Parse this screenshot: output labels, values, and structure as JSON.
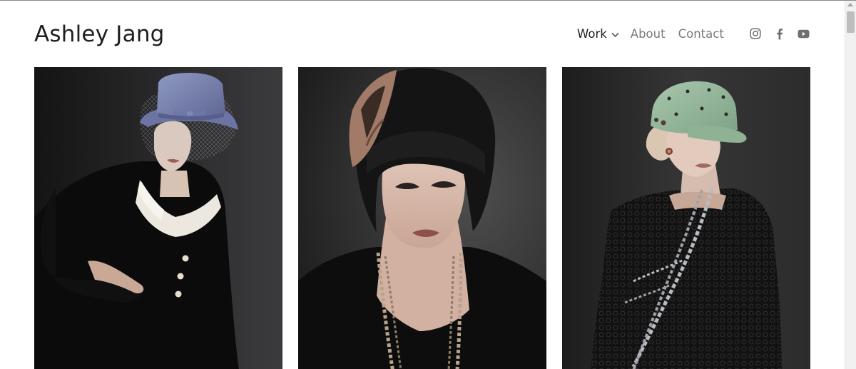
{
  "site": {
    "title": "Ashley Jang"
  },
  "nav": {
    "items": [
      {
        "label": "Work",
        "has_dropdown": true,
        "active": true
      },
      {
        "label": "About",
        "has_dropdown": false,
        "active": false
      },
      {
        "label": "Contact",
        "has_dropdown": false,
        "active": false
      }
    ]
  },
  "social": {
    "icons": [
      "instagram-icon",
      "facebook-icon",
      "youtube-icon"
    ]
  },
  "gallery": {
    "items": [
      {
        "subject": "model in blue felt hat with bow and birdcage veil, black velvet jacket with lace collar"
      },
      {
        "subject": "model in black fuzzy beanie with copper pattern and chain necklaces"
      },
      {
        "subject": "model in mint green studded cap, black lace top and chains"
      }
    ]
  },
  "colors": {
    "text_primary": "#222222",
    "text_secondary": "#7a7a7a",
    "icon": "#6f6f6f",
    "background": "#ffffff"
  }
}
